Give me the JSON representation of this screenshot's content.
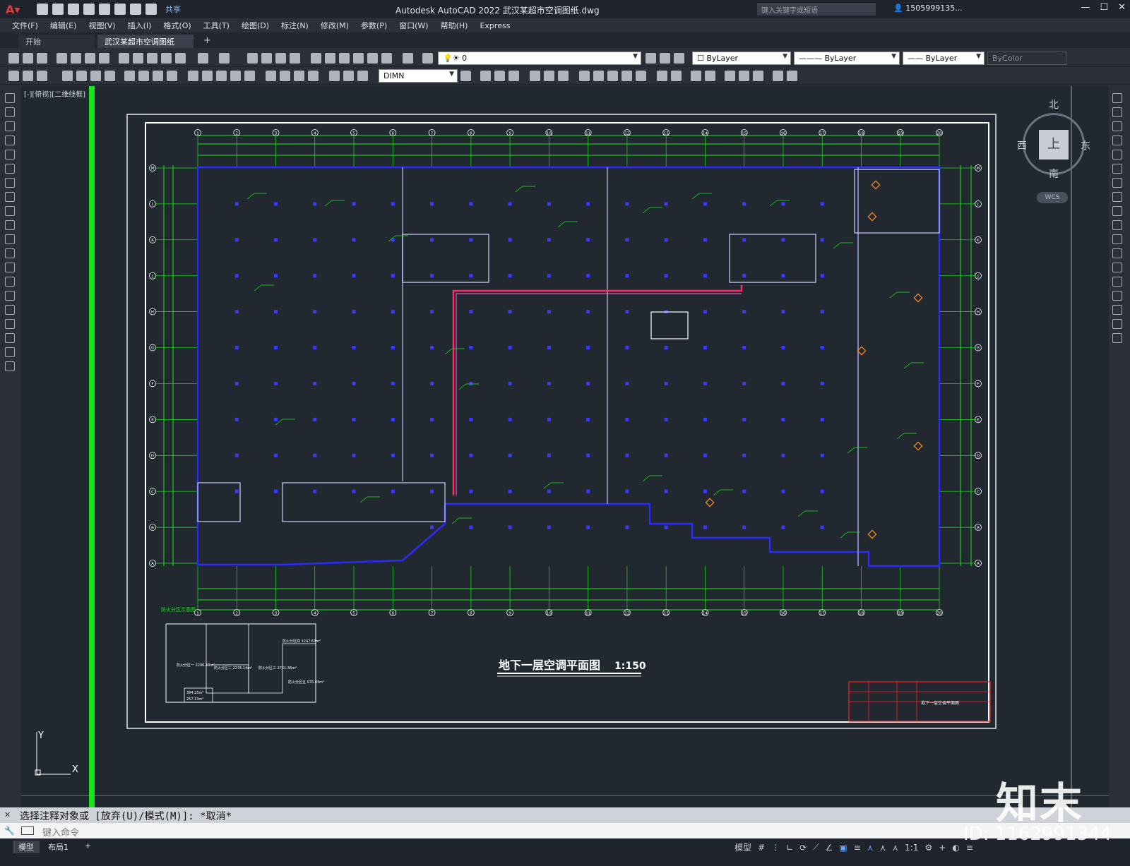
{
  "titlebar": {
    "app_title": "Autodesk AutoCAD 2022    武汉某超市空调图纸.dwg",
    "share_label": "共享",
    "search_placeholder": "键入关键字或短语",
    "user": "1505999135..."
  },
  "menu": [
    "文件(F)",
    "编辑(E)",
    "视图(V)",
    "插入(I)",
    "格式(O)",
    "工具(T)",
    "绘图(D)",
    "标注(N)",
    "修改(M)",
    "参数(P)",
    "窗口(W)",
    "帮助(H)",
    "Express"
  ],
  "tabs": {
    "start": "开始",
    "active": "武汉某超市空调图纸*"
  },
  "layer_props": {
    "layer": "0",
    "color": "ByLayer",
    "linetype": "ByLayer",
    "lineweight": "ByLayer",
    "plotstyle": "ByColor"
  },
  "dimstyle": "DIMN",
  "viewport_label": "[-][俯视][二维线框]",
  "viewcube": {
    "north": "北",
    "south": "南",
    "west": "西",
    "east": "东",
    "face": "上",
    "wcs": "WCS"
  },
  "drawing": {
    "title": "地下一层空调平面图",
    "scale": "1:150",
    "keyplan_title": "防火分区示意图",
    "keyplan_areas": [
      "防火分区一 2206.48m²",
      "防火分区二 2276.14m²",
      "防火分区三 2751.36m²",
      "防火分区四 1247.63m²",
      "防火分区五 976.83m²"
    ],
    "keyplan_box": [
      "394.25m²",
      "257.13m²"
    ],
    "titleblock_name": "地下一层空调平面图",
    "axis_numbers": [
      "1",
      "2",
      "3",
      "4",
      "5",
      "6",
      "7",
      "8",
      "9",
      "10",
      "11",
      "12",
      "13",
      "14",
      "15",
      "16",
      "17",
      "18",
      "19",
      "20"
    ],
    "axis_letters": [
      "A",
      "B",
      "C",
      "D",
      "E",
      "F",
      "G",
      "H",
      "J",
      "K",
      "L",
      "M"
    ]
  },
  "ucs": {
    "y": "Y",
    "x": "X"
  },
  "command": {
    "history": "选择注释对象或 [放弃(U)/模式(M)]: *取消*",
    "placeholder": "键入命令"
  },
  "status": {
    "model_tab": "模型",
    "layout_tab": "布局1",
    "add": "+",
    "model_label": "模型",
    "scale": "1:1"
  },
  "watermark": {
    "logo": "知末",
    "id": "ID: 1162991344"
  }
}
